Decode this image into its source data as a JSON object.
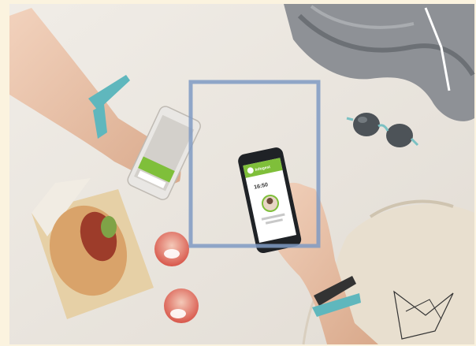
{
  "scene": {
    "phone_right_screen": {
      "app_title": "Infogest",
      "time_text": "16:50"
    },
    "colors": {
      "backdrop": "#fbf3df",
      "blanket": "#ebe6df",
      "overlay_frame": "#7f9ac3",
      "wristband": "#5fb7bd",
      "app_green": "#7fbf3a",
      "hoodie": "#8e9196",
      "bag": "#e8dfcf"
    },
    "icons": [
      "overlay-square-frame",
      "left-hand-phone",
      "right-hand-phone",
      "sunglasses",
      "hoodie",
      "drawstring-bag",
      "pita-sandwich",
      "drink-cups"
    ]
  }
}
